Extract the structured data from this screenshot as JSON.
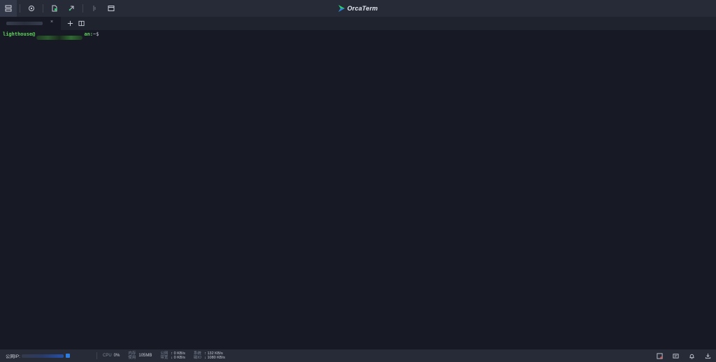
{
  "app": {
    "brand": "OrcaTerm",
    "accent_colors": [
      "#2ecc71",
      "#2e7de0"
    ]
  },
  "toolbar": {
    "left_icons": [
      "server-list-icon",
      "settings-icon",
      "file-transfer-icon",
      "deploy-icon",
      "split-icon",
      "window-icon"
    ]
  },
  "tab": {
    "label": "lighthouse ••",
    "close": "×",
    "add_icon": "plus-icon",
    "split_icon": "split-pane-icon"
  },
  "terminal": {
    "user": "lighthouse@",
    "host_suffix": "an:",
    "path": "~$",
    "prompt_color": "#5fd35a"
  },
  "statusbar": {
    "ip_label": "公网IP:",
    "cpu_label": "CPU",
    "cpu_value": "0%",
    "mem_label_top": "内存",
    "mem_label_bottom": "使用",
    "mem_value": "105MB",
    "net_label_top": "公网",
    "net_label_bottom": "带宽",
    "net_up": "↑ 0 KB/s",
    "net_down": "↓ 0 KB/s",
    "disk_label_top": "系统",
    "disk_label_bottom": "磁IO",
    "disk_up": "↑ 132  KB/s",
    "disk_down": "↓ 1080 KB/s"
  }
}
